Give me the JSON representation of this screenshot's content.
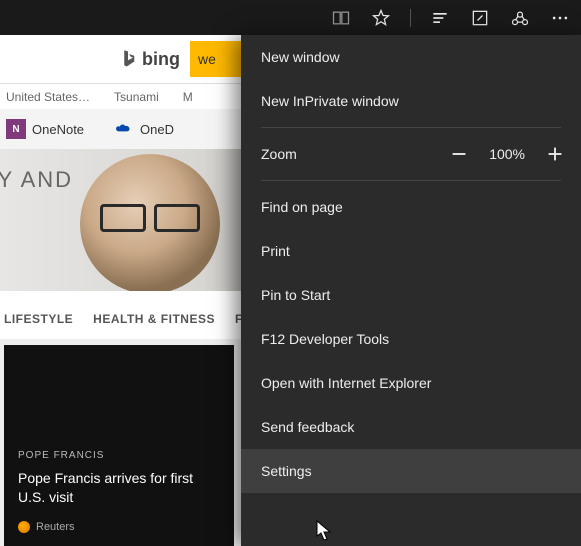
{
  "titlebar": {
    "icons": [
      "reading-view",
      "favorite",
      "hub",
      "note",
      "share",
      "more"
    ]
  },
  "search": {
    "provider": "bing",
    "query_fragment": "we"
  },
  "news_topics": [
    "United States…",
    "Tsunami",
    "M"
  ],
  "favorites": [
    {
      "icon": "onenote",
      "label": "OneNote"
    },
    {
      "icon": "onedrive",
      "label": "OneD"
    }
  ],
  "hero_text": "TY AND",
  "categories": [
    "LIFESTYLE",
    "HEALTH & FITNESS",
    "F"
  ],
  "story": {
    "tag": "POPE FRANCIS",
    "headline": "Pope Francis arrives for first U.S. visit",
    "source": "Reuters"
  },
  "menu": {
    "new_window": "New window",
    "new_inprivate": "New InPrivate window",
    "zoom_label": "Zoom",
    "zoom_value": "100%",
    "find": "Find on page",
    "print": "Print",
    "pin": "Pin to Start",
    "devtools": "F12 Developer Tools",
    "open_ie": "Open with Internet Explorer",
    "feedback": "Send feedback",
    "settings": "Settings"
  }
}
